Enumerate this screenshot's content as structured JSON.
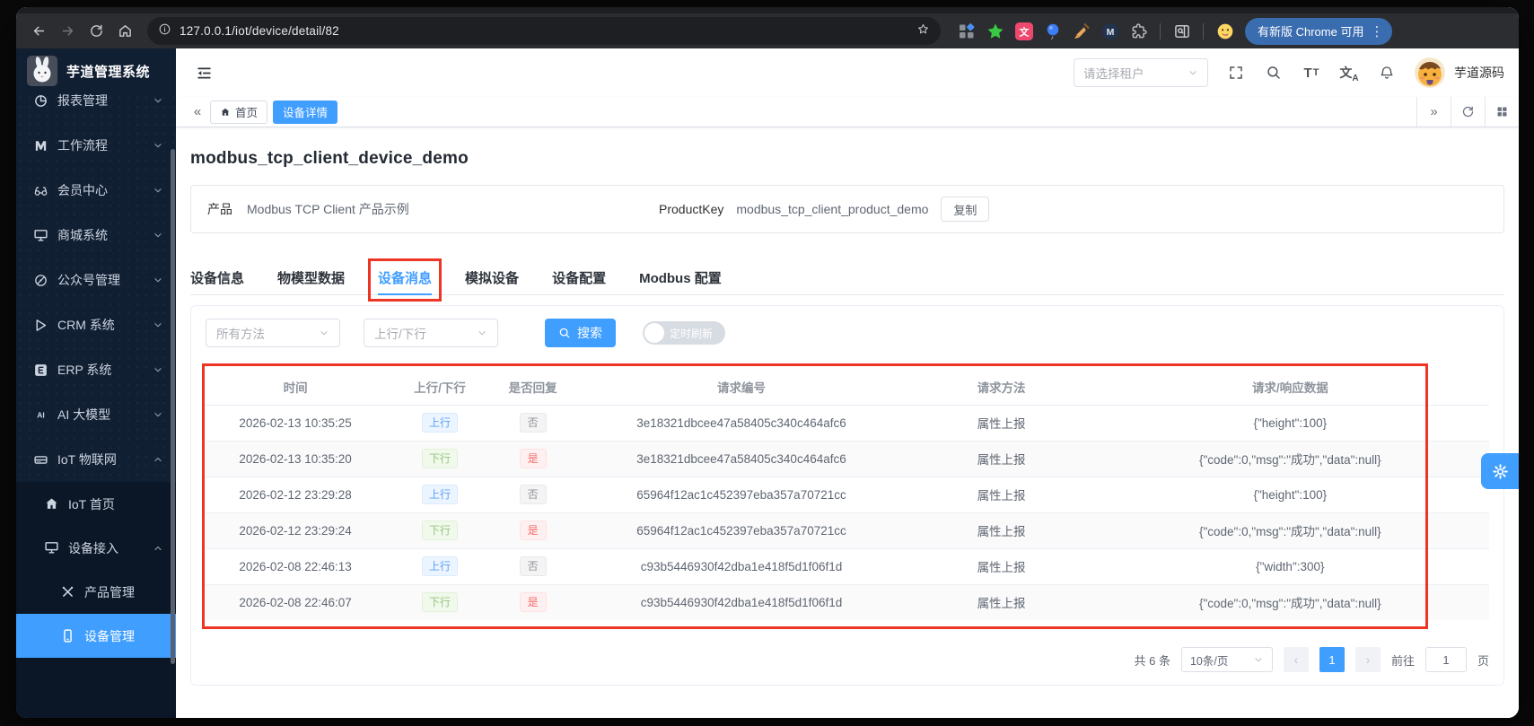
{
  "colors": {
    "accent": "#409eff",
    "annotation": "#ee3524",
    "sidebar_bg": "#111f33"
  },
  "browser": {
    "url": "127.0.0.1/iot/device/detail/82",
    "update_chip": "有新版 Chrome 可用"
  },
  "topbar": {
    "tenant_placeholder": "请选择租户",
    "username": "芋道源码"
  },
  "sidebar": {
    "app_title": "芋道管理系统",
    "items": [
      {
        "label": "报表管理",
        "icon": "report-icon",
        "chevron": "down",
        "partial": true
      },
      {
        "label": "工作流程",
        "icon": "workflow-icon",
        "chevron": "down"
      },
      {
        "label": "会员中心",
        "icon": "member-icon",
        "chevron": "down"
      },
      {
        "label": "商城系统",
        "icon": "mall-icon",
        "chevron": "down"
      },
      {
        "label": "公众号管理",
        "icon": "wechat-icon",
        "chevron": "down"
      },
      {
        "label": "CRM 系统",
        "icon": "crm-icon",
        "chevron": "down"
      },
      {
        "label": "ERP 系统",
        "icon": "erp-icon",
        "chevron": "down"
      },
      {
        "label": "AI 大模型",
        "icon": "ai-icon",
        "chevron": "down"
      },
      {
        "label": "IoT 物联网",
        "icon": "iot-icon",
        "chevron": "up"
      },
      {
        "label": "IoT 首页",
        "icon": "home-icon",
        "level": 2
      },
      {
        "label": "设备接入",
        "icon": "monitor-icon",
        "chevron": "up",
        "level": 2
      },
      {
        "label": "产品管理",
        "icon": "tools-icon",
        "level": 3
      },
      {
        "label": "设备管理",
        "icon": "phone-icon",
        "level": 3,
        "active": true
      }
    ]
  },
  "tabbar": {
    "tabs": [
      {
        "label": "首页"
      },
      {
        "label": "设备详情",
        "active": true
      }
    ]
  },
  "page": {
    "title": "modbus_tcp_client_device_demo",
    "product_label": "产品",
    "product_value": "Modbus TCP Client 产品示例",
    "productkey_label": "ProductKey",
    "productkey_value": "modbus_tcp_client_product_demo",
    "copy_label": "复制",
    "tabs": [
      {
        "label": "设备信息"
      },
      {
        "label": "物模型数据"
      },
      {
        "label": "设备消息",
        "active": true
      },
      {
        "label": "模拟设备"
      },
      {
        "label": "设备配置"
      },
      {
        "label": "Modbus 配置"
      }
    ]
  },
  "filters": {
    "method_placeholder": "所有方法",
    "direction_placeholder": "上行/下行",
    "search_label": "搜索",
    "auto_refresh_label": "定时刷新"
  },
  "table": {
    "headers": [
      "时间",
      "上行/下行",
      "是否回复",
      "请求编号",
      "请求方法",
      "请求/响应数据"
    ],
    "rows": [
      {
        "time": "2026-02-13 10:35:25",
        "direction": "上行",
        "direction_type": "up",
        "reply": "否",
        "reply_type": "no",
        "request_id": "3e18321dbcee47a58405c340c464afc6",
        "method": "属性上报",
        "payload": "{\"height\":100}"
      },
      {
        "time": "2026-02-13 10:35:20",
        "direction": "下行",
        "direction_type": "down",
        "reply": "是",
        "reply_type": "yes",
        "request_id": "3e18321dbcee47a58405c340c464afc6",
        "method": "属性上报",
        "payload": "{\"code\":0,\"msg\":\"成功\",\"data\":null}"
      },
      {
        "time": "2026-02-12 23:29:28",
        "direction": "上行",
        "direction_type": "up",
        "reply": "否",
        "reply_type": "no",
        "request_id": "65964f12ac1c452397eba357a70721cc",
        "method": "属性上报",
        "payload": "{\"height\":100}"
      },
      {
        "time": "2026-02-12 23:29:24",
        "direction": "下行",
        "direction_type": "down",
        "reply": "是",
        "reply_type": "yes",
        "request_id": "65964f12ac1c452397eba357a70721cc",
        "method": "属性上报",
        "payload": "{\"code\":0,\"msg\":\"成功\",\"data\":null}"
      },
      {
        "time": "2026-02-08 22:46:13",
        "direction": "上行",
        "direction_type": "up",
        "reply": "否",
        "reply_type": "no",
        "request_id": "c93b5446930f42dba1e418f5d1f06f1d",
        "method": "属性上报",
        "payload": "{\"width\":300}"
      },
      {
        "time": "2026-02-08 22:46:07",
        "direction": "下行",
        "direction_type": "down",
        "reply": "是",
        "reply_type": "yes",
        "request_id": "c93b5446930f42dba1e418f5d1f06f1d",
        "method": "属性上报",
        "payload": "{\"code\":0,\"msg\":\"成功\",\"data\":null}"
      }
    ]
  },
  "pagination": {
    "total": "共 6 条",
    "page_size": "10条/页",
    "current_page": "1",
    "goto_label": "前往",
    "goto_value": "1",
    "page_unit": "页"
  }
}
